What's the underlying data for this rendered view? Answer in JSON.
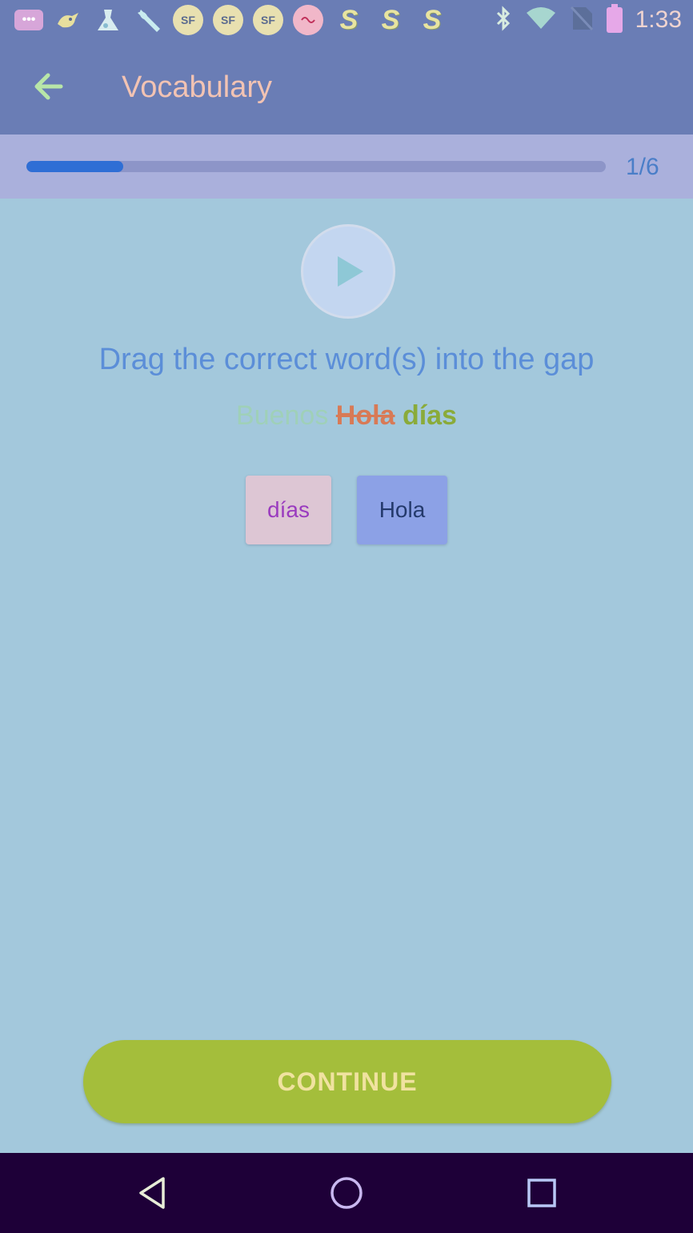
{
  "status_bar": {
    "time": "1:33",
    "notification_icons": [
      "message-icon",
      "bird-icon",
      "lab-icon",
      "wrench-icon",
      "sf-icon",
      "sf-icon",
      "sf-icon",
      "app-icon",
      "s-icon",
      "s-icon",
      "s-icon"
    ],
    "sf_label": "SF",
    "s_label": "S",
    "system_icons": [
      "bluetooth-icon",
      "wifi-icon",
      "no-sim-icon",
      "battery-icon"
    ]
  },
  "app_bar": {
    "title": "Vocabulary",
    "back_icon": "arrow-left-icon"
  },
  "progress": {
    "label": "1/6",
    "fraction": 0.1667,
    "fill_color": "#2f6ed5"
  },
  "exercise": {
    "play_icon": "play-icon",
    "instruction": "Drag the correct word(s) into the gap",
    "sentence": {
      "word1": "Buenos",
      "word2": "Hola",
      "word3": "días"
    },
    "options": [
      {
        "label": "días"
      },
      {
        "label": "Hola"
      }
    ]
  },
  "continue_button": {
    "label": "CONTINUE",
    "color": "#a4be3b"
  },
  "nav_bar": {
    "buttons": [
      "back-triangle-icon",
      "home-circle-icon",
      "recents-square-icon"
    ]
  }
}
